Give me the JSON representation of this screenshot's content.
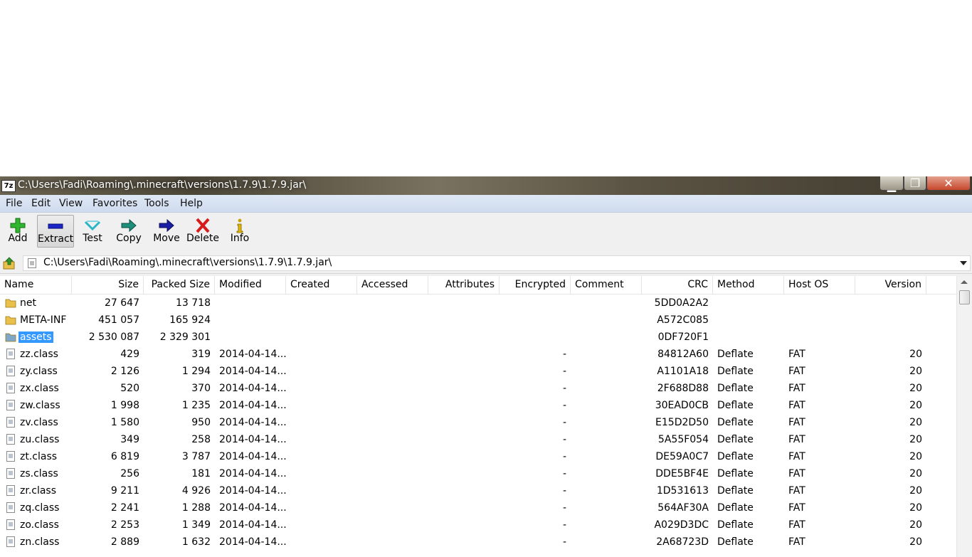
{
  "window": {
    "title": "C:\\Users\\Fadi\\Roaming\\.minecraft\\versions\\1.7.9\\1.7.9.jar\\",
    "app_icon_text": "7z"
  },
  "menu": [
    "File",
    "Edit",
    "View",
    "Favorites",
    "Tools",
    "Help"
  ],
  "toolbar": {
    "add": "Add",
    "extract": "Extract",
    "test": "Test",
    "copy": "Copy",
    "move": "Move",
    "delete": "Delete",
    "info": "Info"
  },
  "address": {
    "path": "C:\\Users\\Fadi\\Roaming\\.minecraft\\versions\\1.7.9\\1.7.9.jar\\"
  },
  "columns": [
    "Name",
    "Size",
    "Packed Size",
    "Modified",
    "Created",
    "Accessed",
    "Attributes",
    "Encrypted",
    "Comment",
    "CRC",
    "Method",
    "Host OS",
    "Version"
  ],
  "rows": [
    {
      "type": "folder",
      "name": "net",
      "size": "27 647",
      "packed": "13 718",
      "modified": "",
      "encrypted": "",
      "crc": "5DD0A2A2",
      "method": "",
      "host": "",
      "version": ""
    },
    {
      "type": "folder",
      "name": "META-INF",
      "size": "451 057",
      "packed": "165 924",
      "modified": "",
      "encrypted": "",
      "crc": "A572C085",
      "method": "",
      "host": "",
      "version": ""
    },
    {
      "type": "folder",
      "name": "assets",
      "size": "2 530 087",
      "packed": "2 329 301",
      "modified": "",
      "encrypted": "",
      "crc": "0DF720F1",
      "method": "",
      "host": "",
      "version": "",
      "selected": true
    },
    {
      "type": "file",
      "name": "zz.class",
      "size": "429",
      "packed": "319",
      "modified": "2014-04-14...",
      "encrypted": "-",
      "crc": "84812A60",
      "method": "Deflate",
      "host": "FAT",
      "version": "20"
    },
    {
      "type": "file",
      "name": "zy.class",
      "size": "2 126",
      "packed": "1 294",
      "modified": "2014-04-14...",
      "encrypted": "-",
      "crc": "A1101A18",
      "method": "Deflate",
      "host": "FAT",
      "version": "20"
    },
    {
      "type": "file",
      "name": "zx.class",
      "size": "520",
      "packed": "370",
      "modified": "2014-04-14...",
      "encrypted": "-",
      "crc": "2F688D88",
      "method": "Deflate",
      "host": "FAT",
      "version": "20"
    },
    {
      "type": "file",
      "name": "zw.class",
      "size": "1 998",
      "packed": "1 235",
      "modified": "2014-04-14...",
      "encrypted": "-",
      "crc": "30EAD0CB",
      "method": "Deflate",
      "host": "FAT",
      "version": "20"
    },
    {
      "type": "file",
      "name": "zv.class",
      "size": "1 580",
      "packed": "950",
      "modified": "2014-04-14...",
      "encrypted": "-",
      "crc": "E15D2D50",
      "method": "Deflate",
      "host": "FAT",
      "version": "20"
    },
    {
      "type": "file",
      "name": "zu.class",
      "size": "349",
      "packed": "258",
      "modified": "2014-04-14...",
      "encrypted": "-",
      "crc": "5A55F054",
      "method": "Deflate",
      "host": "FAT",
      "version": "20"
    },
    {
      "type": "file",
      "name": "zt.class",
      "size": "6 819",
      "packed": "3 787",
      "modified": "2014-04-14...",
      "encrypted": "-",
      "crc": "DE59A0C7",
      "method": "Deflate",
      "host": "FAT",
      "version": "20"
    },
    {
      "type": "file",
      "name": "zs.class",
      "size": "256",
      "packed": "181",
      "modified": "2014-04-14...",
      "encrypted": "-",
      "crc": "DDE5BF4E",
      "method": "Deflate",
      "host": "FAT",
      "version": "20"
    },
    {
      "type": "file",
      "name": "zr.class",
      "size": "9 211",
      "packed": "4 926",
      "modified": "2014-04-14...",
      "encrypted": "-",
      "crc": "1D531613",
      "method": "Deflate",
      "host": "FAT",
      "version": "20"
    },
    {
      "type": "file",
      "name": "zq.class",
      "size": "2 241",
      "packed": "1 288",
      "modified": "2014-04-14...",
      "encrypted": "-",
      "crc": "564AF30A",
      "method": "Deflate",
      "host": "FAT",
      "version": "20"
    },
    {
      "type": "file",
      "name": "zo.class",
      "size": "2 253",
      "packed": "1 349",
      "modified": "2014-04-14...",
      "encrypted": "-",
      "crc": "A029D3DC",
      "method": "Deflate",
      "host": "FAT",
      "version": "20"
    },
    {
      "type": "file",
      "name": "zn.class",
      "size": "2 889",
      "packed": "1 632",
      "modified": "2014-04-14...",
      "encrypted": "-",
      "crc": "2A68723D",
      "method": "Deflate",
      "host": "FAT",
      "version": "20"
    }
  ],
  "colors": {
    "selection": "#3399ff",
    "titlebar": "#4b4637",
    "menubar": "#dfe8f5"
  },
  "icons": {
    "add": "plus-icon",
    "extract": "minus-icon",
    "test": "check-icon",
    "copy": "copy-arrow-icon",
    "move": "move-arrow-icon",
    "delete": "x-icon",
    "info": "info-icon",
    "up": "folder-up-icon"
  }
}
